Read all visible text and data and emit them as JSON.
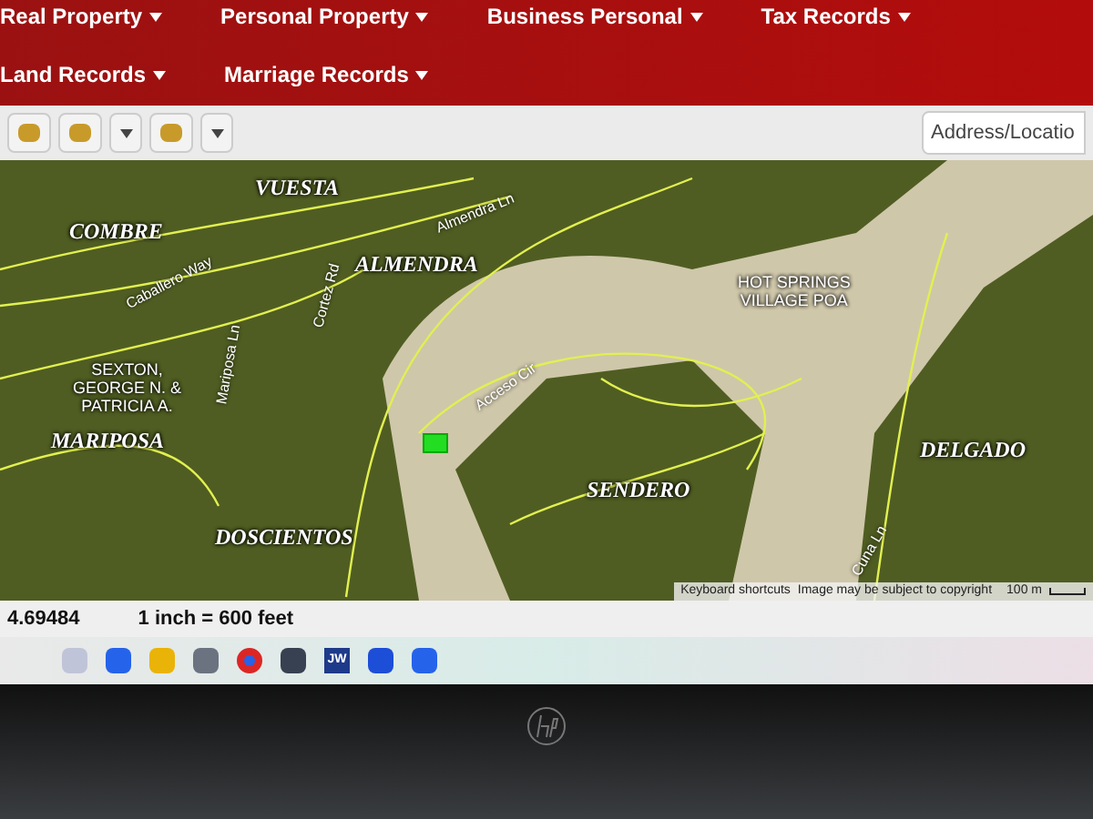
{
  "nav": [
    {
      "label": "Real Property"
    },
    {
      "label": "Personal Property"
    },
    {
      "label": "Business Personal"
    },
    {
      "label": "Tax Records"
    },
    {
      "label": "Land Records"
    },
    {
      "label": "Marriage Records"
    }
  ],
  "toolbar": {
    "buttons": [
      {
        "kind": "tool"
      },
      {
        "kind": "tool"
      },
      {
        "kind": "dropdown"
      },
      {
        "kind": "tool"
      },
      {
        "kind": "dropdown"
      }
    ],
    "search": {
      "placeholder": "Address/Locatio"
    }
  },
  "map": {
    "labels": [
      {
        "kind": "subdivision",
        "text": "VUESTA"
      },
      {
        "kind": "subdivision",
        "text": "COMBRE"
      },
      {
        "kind": "subdivision",
        "text": "ALMENDRA"
      },
      {
        "kind": "street",
        "text": "Caballero Way"
      },
      {
        "kind": "street",
        "text": "Mariposa Ln"
      },
      {
        "kind": "street",
        "text": "Cortez Rd"
      },
      {
        "kind": "street",
        "text": "Almendra Ln"
      },
      {
        "kind": "street",
        "text": "Acceso Cir"
      },
      {
        "kind": "owner",
        "lines": [
          "SEXTON,",
          "GEORGE N. &",
          "PATRICIA A."
        ]
      },
      {
        "kind": "subdivision",
        "text": "MARIPOSA"
      },
      {
        "kind": "subdivision",
        "text": "DOSCIENTOS"
      },
      {
        "kind": "subdivision",
        "text": "SENDERO"
      },
      {
        "kind": "owner",
        "lines": [
          "HOT SPRINGS",
          "VILLAGE POA"
        ]
      },
      {
        "kind": "subdivision",
        "text": "DELGADO"
      },
      {
        "kind": "street",
        "text": "Cuna Ln"
      }
    ],
    "attribution": [
      "Keyboard shortcuts",
      "Image may be subject to copyright"
    ],
    "scale": "100 m"
  },
  "status_bar": {
    "coordinate": "4.69484",
    "scale": "1 inch = 600 feet"
  },
  "taskbar": [
    {
      "kind": "app",
      "color": "#c0c4d8"
    },
    {
      "kind": "app",
      "color": "#2563eb"
    },
    {
      "kind": "app",
      "color": "#eab308"
    },
    {
      "kind": "app",
      "color": "#6b7280"
    },
    {
      "kind": "browser",
      "color": "#dc2626"
    },
    {
      "kind": "app",
      "color": "#374151"
    },
    {
      "kind": "label",
      "color": "#1e3a8a",
      "text": "JW"
    },
    {
      "kind": "app",
      "color": "#1d4ed8"
    },
    {
      "kind": "app",
      "color": "#2563eb"
    }
  ]
}
